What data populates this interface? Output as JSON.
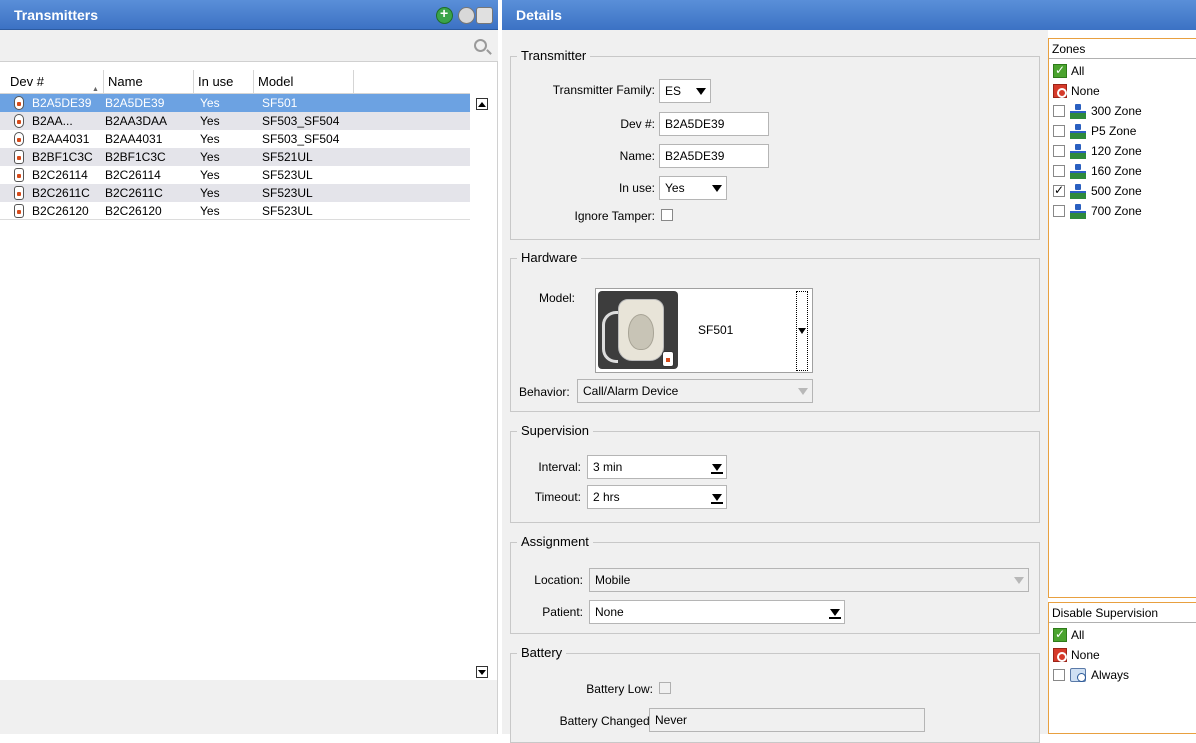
{
  "transmitters_panel": {
    "title": "Transmitters",
    "icons": [
      "add-transmitter-icon",
      "find-icon",
      "print-icon"
    ],
    "columns": [
      "Dev #",
      "Name",
      "In use",
      "Model"
    ],
    "rows": [
      {
        "dev": "B2A5DE39",
        "name": "B2A5DE39",
        "in_use": "Yes",
        "model": "SF501"
      },
      {
        "dev": "B2AA...",
        "name": "B2AA3DAA",
        "in_use": "Yes",
        "model": "SF503_SF504"
      },
      {
        "dev": "B2AA4031",
        "name": "B2AA4031",
        "in_use": "Yes",
        "model": "SF503_SF504"
      },
      {
        "dev": "B2BF1C3C",
        "name": "B2BF1C3C",
        "in_use": "Yes",
        "model": "SF521UL"
      },
      {
        "dev": "B2C26114",
        "name": "B2C26114",
        "in_use": "Yes",
        "model": "SF523UL"
      },
      {
        "dev": "B2C2611C",
        "name": "B2C2611C",
        "in_use": "Yes",
        "model": "SF523UL"
      },
      {
        "dev": "B2C26120",
        "name": "B2C26120",
        "in_use": "Yes",
        "model": "SF523UL"
      }
    ]
  },
  "details": {
    "title": "Details",
    "transmitter": {
      "group": "Transmitter",
      "family_label": "Transmitter Family:",
      "family_value": "ES",
      "dev_label": "Dev #:",
      "dev_value": "B2A5DE39",
      "name_label": "Name:",
      "name_value": "B2A5DE39",
      "inuse_label": "In use:",
      "inuse_value": "Yes",
      "ignore_tamper_label": "Ignore Tamper:"
    },
    "hardware": {
      "group": "Hardware",
      "model_label": "Model:",
      "model_value": "SF501",
      "behavior_label": "Behavior:",
      "behavior_value": "Call/Alarm Device"
    },
    "supervision": {
      "group": "Supervision",
      "interval_label": "Interval:",
      "interval_value": "3 min",
      "timeout_label": "Timeout:",
      "timeout_value": "2 hrs"
    },
    "assignment": {
      "group": "Assignment",
      "location_label": "Location:",
      "location_value": "Mobile",
      "patient_label": "Patient:",
      "patient_value": "None"
    },
    "battery": {
      "group": "Battery",
      "low_label": "Battery Low:",
      "changed_label": "Battery Changed:",
      "changed_value": "Never"
    }
  },
  "zones": {
    "title": "Zones",
    "all": "All",
    "none": "None",
    "items": [
      {
        "label": "300 Zone",
        "checked": false
      },
      {
        "label": "P5 Zone",
        "checked": false
      },
      {
        "label": "120 Zone",
        "checked": false
      },
      {
        "label": "160 Zone",
        "checked": false
      },
      {
        "label": "500 Zone",
        "checked": true
      },
      {
        "label": "700 Zone",
        "checked": false
      }
    ]
  },
  "disable_supervision": {
    "title": "Disable Supervision",
    "all": "All",
    "none": "None",
    "always": "Always"
  },
  "colors": {
    "header_blue": "#3c72c4",
    "selection": "#6ca2e2",
    "zone_border": "#e8a040"
  }
}
